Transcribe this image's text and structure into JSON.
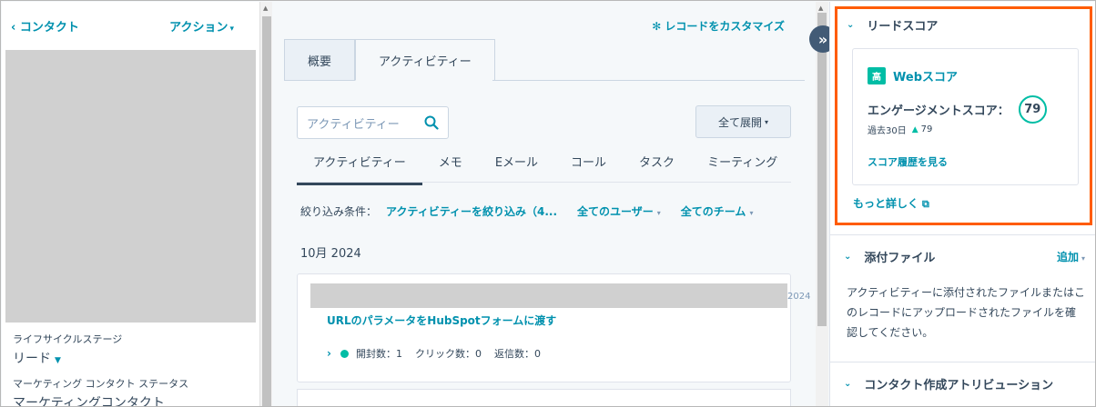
{
  "left": {
    "back_label": "‹ コンタクト",
    "action_label": "アクション",
    "lifecycle_label": "ライフサイクルステージ",
    "lifecycle_value": "リード",
    "marketing_status_label": "マーケティング コンタクト ステータス",
    "marketing_status_value": "マーケティングコンタクト"
  },
  "middle": {
    "customize_label": "レコードをカスタマイズ",
    "tabs": [
      {
        "label": "概要"
      },
      {
        "label": "アクティビティー"
      }
    ],
    "search_placeholder": "アクティビティー",
    "expand_label": "全て展開",
    "subtabs": [
      {
        "label": "アクティビティー"
      },
      {
        "label": "メモ"
      },
      {
        "label": "Eメール"
      },
      {
        "label": "コール"
      },
      {
        "label": "タスク"
      },
      {
        "label": "ミーティング"
      }
    ],
    "filter_label": "絞り込み条件：",
    "filters": [
      {
        "label": "アクティビティーを絞り込み（4..."
      },
      {
        "label": "全てのユーザー"
      },
      {
        "label": "全てのチーム"
      }
    ],
    "month": "10月 2024",
    "card": {
      "date_fragment": "2024",
      "title": "URLのパラメータをHubSpotフォームに渡す",
      "opens": "開封数：1",
      "clicks": "クリック数：0",
      "replies": "返信数：0"
    }
  },
  "right": {
    "lead_score": {
      "title": "リードスコア",
      "badge": "高",
      "web_label": "Webスコア",
      "engagement_label": "エンゲージメントスコア：",
      "engagement_value": "79",
      "past_label": "過去30日",
      "past_value": "79",
      "history_link": "スコア履歴を見る",
      "more_link": "もっと詳しく"
    },
    "attachments": {
      "title": "添付ファイル",
      "add_label": "追加",
      "text": "アクティビティーに添付されたファイルまたはこのレコードにアップロードされたファイルを確認してください。"
    },
    "attribution": {
      "title": "コンタクト作成アトリビューション"
    }
  },
  "colors": {
    "link": "#0091ae",
    "highlight_border": "#ff5c00",
    "teal": "#00bda5",
    "dark": "#33475b"
  }
}
